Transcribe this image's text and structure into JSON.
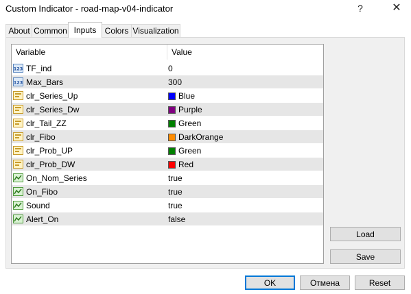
{
  "window": {
    "title": "Custom Indicator - road-map-v04-indicator",
    "help": "?",
    "close": "✕"
  },
  "tabs": [
    {
      "label": "About"
    },
    {
      "label": "Common"
    },
    {
      "label": "Inputs"
    },
    {
      "label": "Colors"
    },
    {
      "label": "Visualization"
    }
  ],
  "active_tab": "Inputs",
  "table": {
    "headers": {
      "variable": "Variable",
      "value": "Value"
    },
    "rows": [
      {
        "name": "TF_ind",
        "value": "0",
        "icon": "number-icon"
      },
      {
        "name": "Max_Bars",
        "value": "300",
        "icon": "number-icon"
      },
      {
        "name": "clr_Series_Up",
        "value": "Blue",
        "icon": "color-icon",
        "swatch": "#0000ff"
      },
      {
        "name": "clr_Series_Dw",
        "value": "Purple",
        "icon": "color-icon",
        "swatch": "#800080"
      },
      {
        "name": "clr_Tail_ZZ",
        "value": "Green",
        "icon": "color-icon",
        "swatch": "#008000"
      },
      {
        "name": "clr_Fibo",
        "value": "DarkOrange",
        "icon": "color-icon",
        "swatch": "#ff8c00"
      },
      {
        "name": "clr_Prob_UP",
        "value": "Green",
        "icon": "color-icon",
        "swatch": "#008000"
      },
      {
        "name": "clr_Prob_DW",
        "value": "Red",
        "icon": "color-icon",
        "swatch": "#ff0000"
      },
      {
        "name": "On_Nom_Series",
        "value": "true",
        "icon": "boolean-icon"
      },
      {
        "name": "On_Fibo",
        "value": "true",
        "icon": "boolean-icon"
      },
      {
        "name": "Sound",
        "value": "true",
        "icon": "boolean-icon"
      },
      {
        "name": "Alert_On",
        "value": "false",
        "icon": "boolean-icon"
      }
    ]
  },
  "buttons": {
    "load": "Load",
    "save": "Save",
    "ok": "OK",
    "cancel": "Отмена",
    "reset": "Reset"
  },
  "colors": {
    "accent": "#0078d7",
    "row_alt": "#e6e6e6"
  }
}
